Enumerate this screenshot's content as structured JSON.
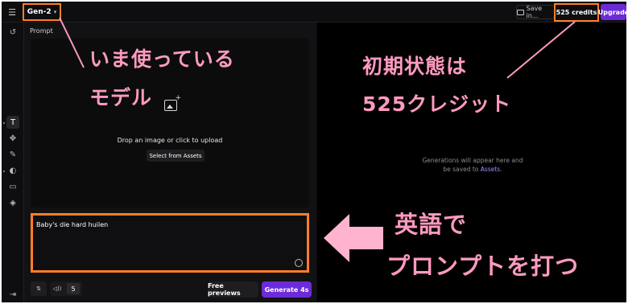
{
  "topbar": {
    "model_name": "Gen-2",
    "save_label": "Save in...",
    "credits_label": "525 credits",
    "upgrade_label": "Upgrade"
  },
  "panel": {
    "prompt_label": "Prompt",
    "drop_text": "Drop an image or click to upload",
    "select_assets_label": "Select from Assets",
    "prompt_value": "Baby's die hard huilen",
    "duration_value": "5",
    "free_previews_label": "Free previews",
    "generate_label": "Generate 4s"
  },
  "output": {
    "empty_message_1": "Generations will appear here and be saved to",
    "empty_message_link": "Assets",
    "empty_message_end": "."
  },
  "annotations": {
    "model_note_1": "いま使っている",
    "model_note_2": "モデル",
    "credits_note_1": "初期状態は",
    "credits_note_2": "525クレジット",
    "prompt_note_1": "英語で",
    "prompt_note_2": "プロンプトを打つ"
  },
  "colors": {
    "accent": "#6c2bd9",
    "highlight_box": "#ff7f27",
    "annotation_text": "#ff9ac0"
  }
}
